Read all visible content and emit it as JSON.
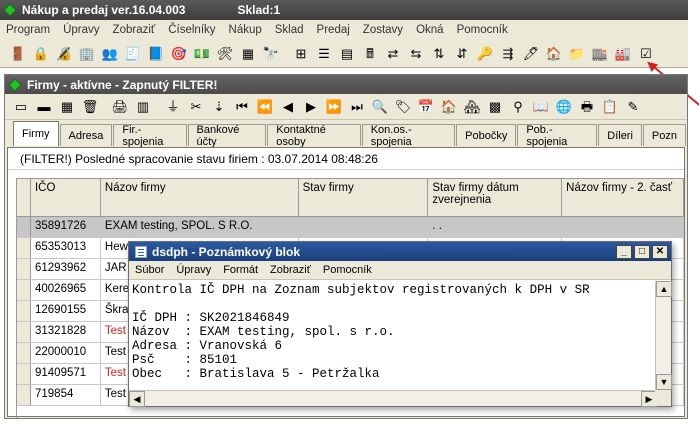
{
  "app": {
    "title": "Nákup a predaj ver.16.04.003",
    "sklad": "Sklad:1"
  },
  "menubar": [
    "Program",
    "Úpravy",
    "Zobraziť",
    "Číselníky",
    "Nákup",
    "Sklad",
    "Predaj",
    "Zostavy",
    "Okná",
    "Pomocník"
  ],
  "firmy_window": {
    "title": "Firmy - aktívne - Zapnutý FILTER!",
    "tabs": [
      "Firmy",
      "Adresa",
      "Fir.-spojenia",
      "Bankové účty",
      "Kontaktné osoby",
      "Kon.os.-spojenia",
      "Pobočky",
      "Pob.-spojenia",
      "Díleri",
      "Pozn"
    ],
    "status": "(FILTER!) Posledné spracovanie stavu firiem : 03.07.2014 08:48:26",
    "columns": [
      "IČO",
      "Názov firmy",
      "Stav firmy",
      "Stav firmy dátum zverejnenia",
      "Názov firmy - 2. časť"
    ],
    "rows": [
      {
        "ico": "35891726",
        "nazov": "EXAM testing, SPOL. S R.O.",
        "stav": "",
        "datum": ". .",
        "nazov2": "",
        "selected": true,
        "red": false
      },
      {
        "ico": "65353013",
        "nazov": "Hew",
        "stav": "",
        "datum": "",
        "nazov2": "",
        "selected": false,
        "red": false
      },
      {
        "ico": "61293962",
        "nazov": "JAR",
        "stav": "",
        "datum": "",
        "nazov2": "",
        "selected": false,
        "red": false
      },
      {
        "ico": "40026965",
        "nazov": "Kere",
        "stav": "",
        "datum": "",
        "nazov2": "",
        "selected": false,
        "red": false
      },
      {
        "ico": "12690155",
        "nazov": "Škra",
        "stav": "",
        "datum": "",
        "nazov2": "",
        "selected": false,
        "red": false
      },
      {
        "ico": "31321828",
        "nazov": "Test",
        "stav": "",
        "datum": "",
        "nazov2": "",
        "selected": false,
        "red": true
      },
      {
        "ico": "22000010",
        "nazov": "Test",
        "stav": "",
        "datum": "",
        "nazov2": "",
        "selected": false,
        "red": false
      },
      {
        "ico": "91409571",
        "nazov": "Test",
        "stav": "",
        "datum": "",
        "nazov2": "",
        "selected": false,
        "red": true
      },
      {
        "ico": "719854",
        "nazov": "Test",
        "stav": "",
        "datum": "",
        "nazov2": "",
        "selected": false,
        "red": false
      }
    ]
  },
  "notepad": {
    "title": "dsdph - Poznámkový blok",
    "menu": [
      "Súbor",
      "Úpravy",
      "Formát",
      "Zobraziť",
      "Pomocník"
    ],
    "lines": [
      "Kontrola IČ DPH na Zoznam subjektov registrovaných k DPH v SR",
      "",
      "IČ DPH : SK2021846849",
      "Názov  : EXAM testing, spol. s r.o.",
      "Adresa : Vranovská 6",
      "Psč    : 85101",
      "Obec   : Bratislava 5 - Petržalka"
    ]
  },
  "colors": {
    "annotation_arrow": "#d42020",
    "selected_row": "#c7c7c7",
    "red_text": "#d42020"
  }
}
